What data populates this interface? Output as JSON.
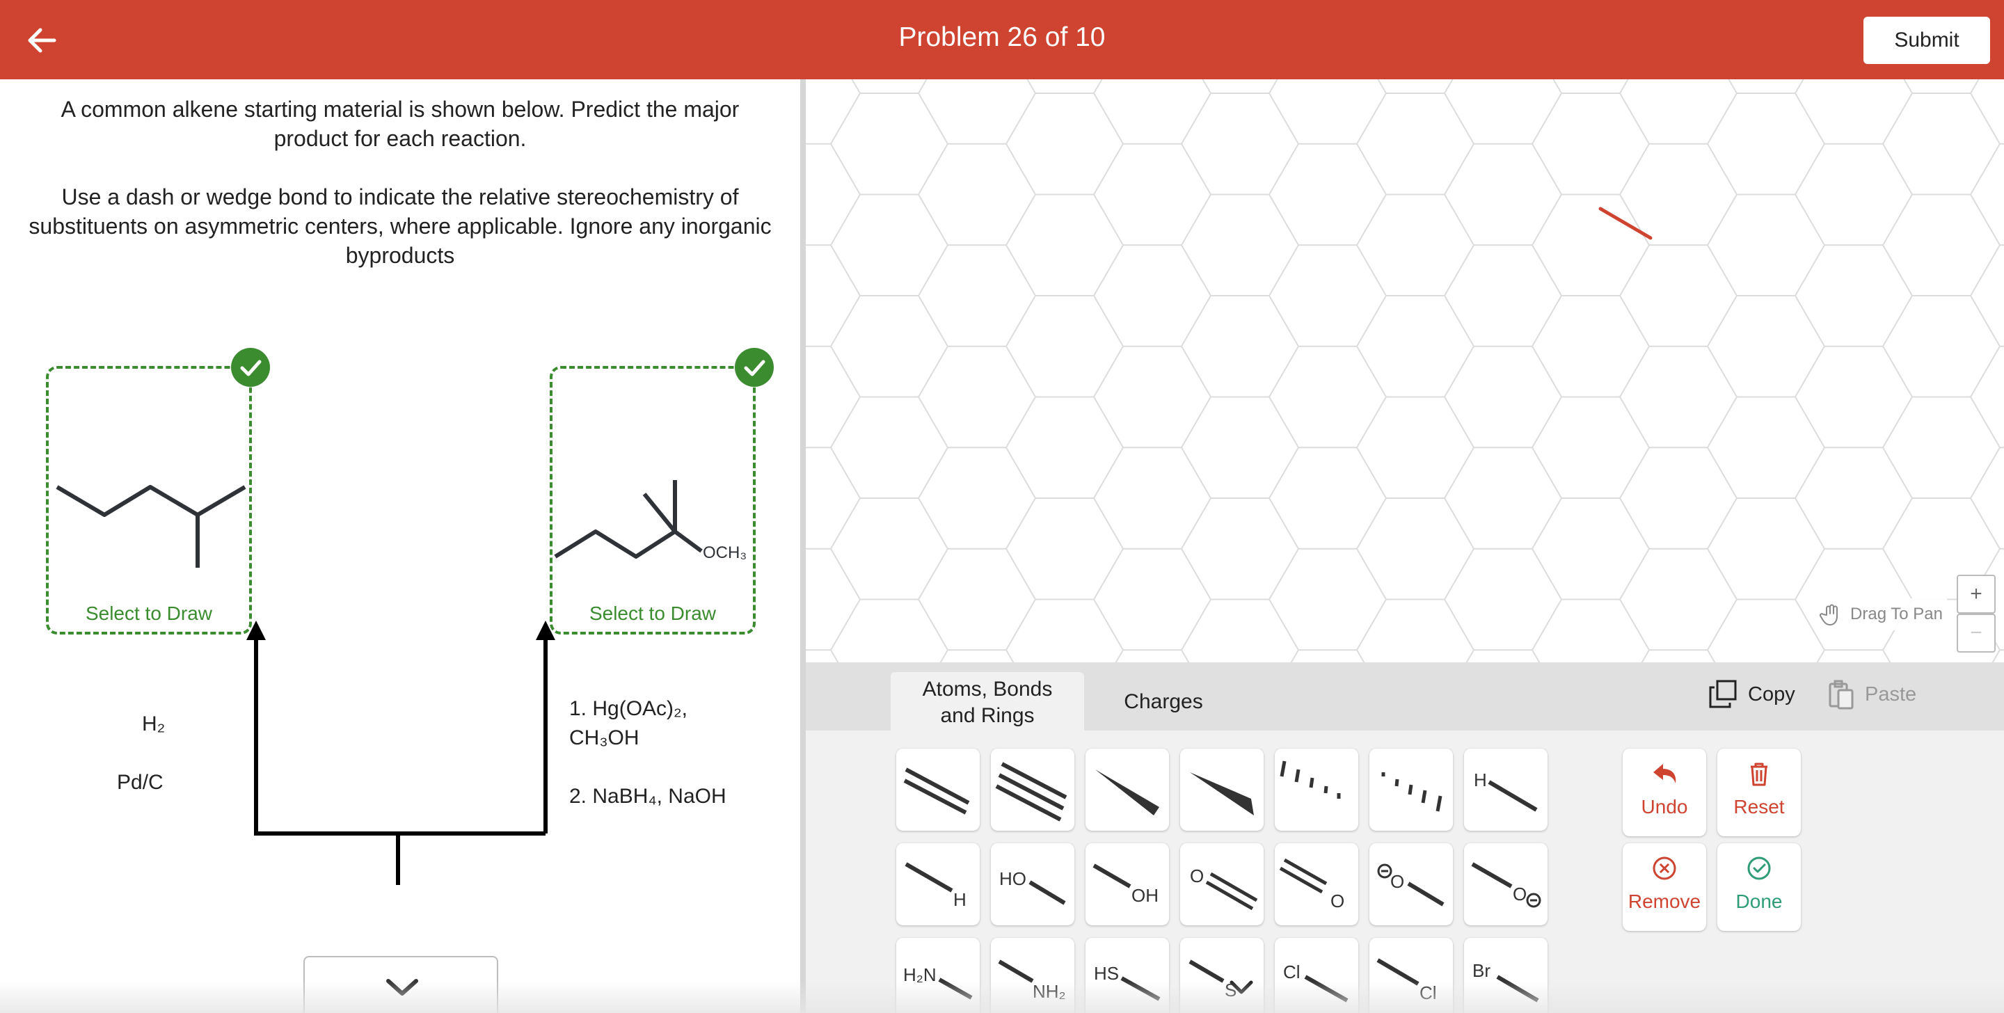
{
  "header": {
    "title": "Problem 26 of 10",
    "submit_label": "Submit",
    "color": "#cf4430"
  },
  "instructions": {
    "line1": "A common alkene starting material is shown below. Predict the major product for each reaction.",
    "line2": "Use a dash or wedge bond to indicate the relative stereochemistry of substituents on asymmetric centers, where applicable. Ignore any inorganic byproducts"
  },
  "answers": [
    {
      "select_label": "Select to Draw",
      "status": "complete"
    },
    {
      "select_label": "Select to Draw",
      "status": "complete",
      "group_label": "OCH₃"
    }
  ],
  "reactions": {
    "left": {
      "reagent1": "H₂",
      "reagent2": "Pd/C"
    },
    "right": {
      "step1_line1": "1. Hg(OAc)₂,",
      "step1_line2": "CH₃OH",
      "step2": "2. NaBH₄, NaOH"
    }
  },
  "canvas": {
    "drag_to_pan": "Drag To Pan",
    "zoom_in": "+",
    "zoom_out": "−"
  },
  "toolbar": {
    "tabs": [
      {
        "label_line1": "Atoms, Bonds",
        "label_line2": "and Rings",
        "active": true
      },
      {
        "label": "Charges",
        "active": false
      }
    ],
    "copy_label": "Copy",
    "paste_label": "Paste",
    "tool_labels": {
      "h": "H",
      "ho": "HO",
      "oh": "OH",
      "o": "O",
      "h2n": "H₂N",
      "nh2": "NH₂",
      "hs": "HS",
      "s": "S",
      "cl": "Cl",
      "br": "Br"
    },
    "actions": {
      "undo": "Undo",
      "reset": "Reset",
      "remove": "Remove",
      "done": "Done"
    },
    "colors": {
      "red_action": "#cf4430",
      "green_action": "#2e9c78"
    }
  }
}
